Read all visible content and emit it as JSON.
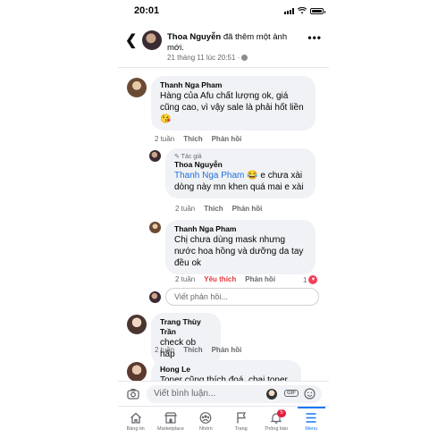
{
  "status_bar": {
    "time": "20:01"
  },
  "header": {
    "author": "Thoa Nguyễn",
    "action": "đã thêm một ảnh mới.",
    "date": "21 tháng 11 lúc 20:51 ·"
  },
  "comments": [
    {
      "name": "Thanh Nga Pham",
      "text": "Hàng của Afu chất lượng ok, giá cũng cao, vì vậy sale là phải hốt liền",
      "emoji": "😘",
      "time": "2 tuần",
      "like": "Thích",
      "reply": "Phản hồi"
    },
    {
      "author_tag": "✎ Tác giả",
      "name": "Thoa Nguyễn",
      "mention": "Thanh Nga Pham",
      "emoji": "😂",
      "text": "e chưa xài dòng này mn khen quá mai e xài",
      "time": "2 tuần",
      "like": "Thích",
      "reply": "Phản hồi"
    },
    {
      "name": "Thanh Nga Pham",
      "text": "Chị chưa dùng mask nhưng nước hoa hồng và dưỡng da tay đều ok",
      "time": "2 tuần",
      "like": "Yêu thích",
      "reply": "Phản hồi",
      "reactions": "1"
    },
    {
      "name": "Trang Thùy Trần",
      "text": "check ob hấp",
      "time": "2 tuần",
      "like": "Thích",
      "reply": "Phản hồi"
    },
    {
      "name": "Hong Le",
      "text": "Toner cũng thích đoá, chai toner"
    }
  ],
  "reply_input": {
    "placeholder": "Viết phản hồi..."
  },
  "composer": {
    "placeholder": "Viết bình luận...",
    "gif": "GIF"
  },
  "nav": [
    {
      "label": "Bảng tin",
      "icon": "home-icon"
    },
    {
      "label": "Marketplace",
      "icon": "marketplace-icon"
    },
    {
      "label": "Nhóm",
      "icon": "groups-icon"
    },
    {
      "label": "Trang",
      "icon": "flag-icon"
    },
    {
      "label": "Thông báo",
      "icon": "bell-icon",
      "badge": "5"
    },
    {
      "label": "Menu",
      "icon": "menu-icon"
    }
  ],
  "colors": {
    "link": "#216fdb",
    "accent": "#1877f2",
    "love": "#f33e58",
    "bubble": "#f0f2f5"
  }
}
